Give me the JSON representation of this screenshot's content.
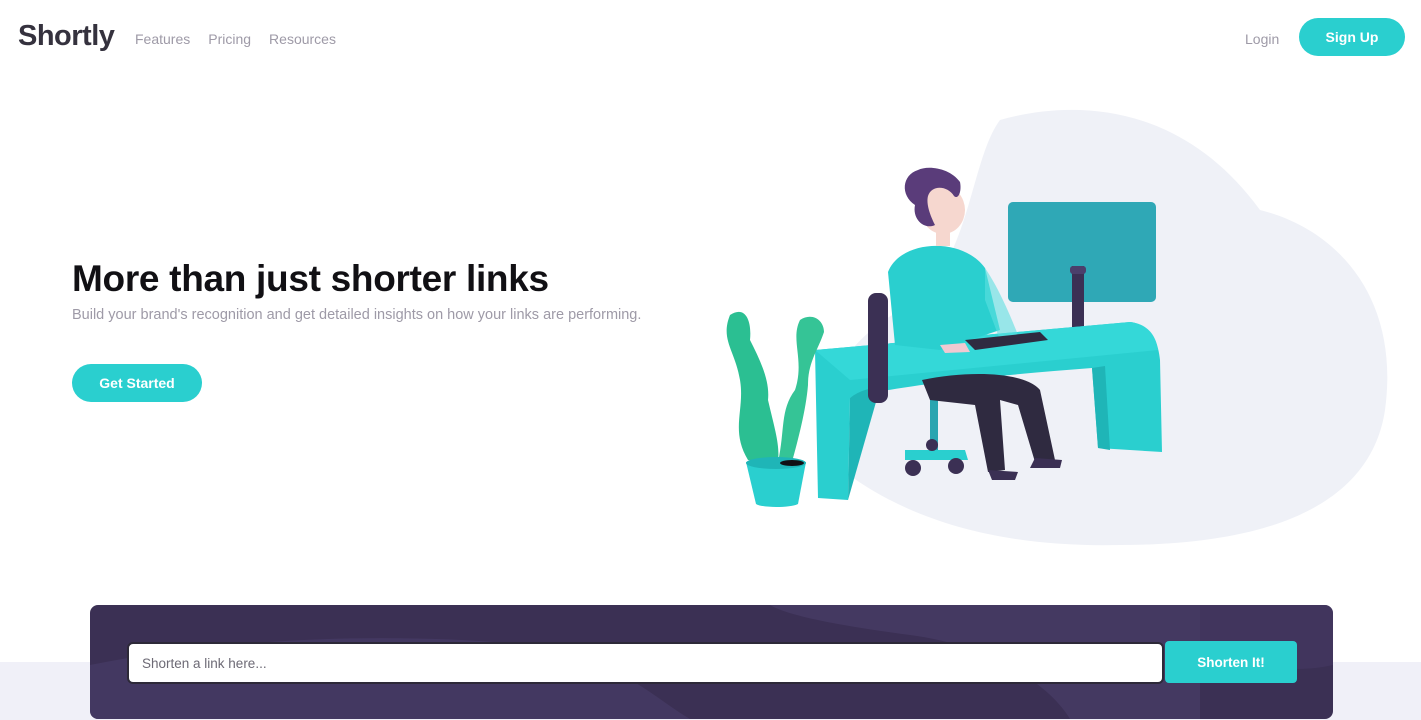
{
  "header": {
    "logo": "Shortly",
    "nav": [
      "Features",
      "Pricing",
      "Resources"
    ],
    "login": "Login",
    "signup": "Sign Up"
  },
  "hero": {
    "title": "More than just shorter links",
    "subtitle": "Build your brand's recognition and get detailed insights on how your links are performing.",
    "cta": "Get Started",
    "illustration": "person-working-at-desk-illustration"
  },
  "shorten": {
    "placeholder": "Shorten a link here...",
    "button": "Shorten It!"
  },
  "colors": {
    "primary_cyan": "#2acfcf",
    "dark_violet": "#3b3054",
    "dark_text": "#35323e",
    "gray_text": "#9e9aa7",
    "band_bg": "#f0f0f8"
  }
}
